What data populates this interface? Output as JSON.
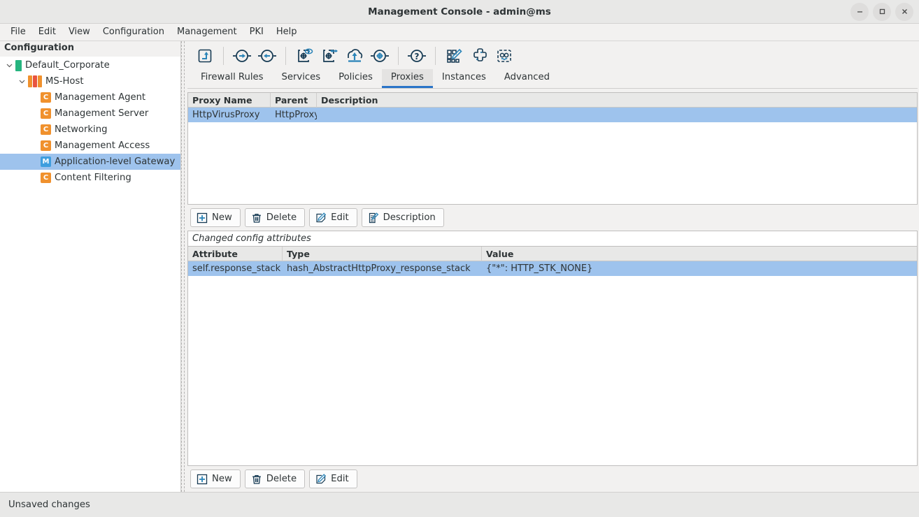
{
  "window": {
    "title": "Management Console - admin@ms",
    "controls": [
      {
        "name": "minimize-button",
        "icon": "minimize-icon"
      },
      {
        "name": "maximize-button",
        "icon": "maximize-icon"
      },
      {
        "name": "close-button",
        "icon": "close-icon"
      }
    ]
  },
  "menubar": {
    "items": [
      "File",
      "Edit",
      "View",
      "Configuration",
      "Management",
      "PKI",
      "Help"
    ]
  },
  "sidebar": {
    "header": "Configuration",
    "items": [
      {
        "label": "Default_Corporate",
        "depth": 0,
        "icon": "green-bar-icon",
        "expanded": true,
        "selected": false
      },
      {
        "label": "MS-Host",
        "depth": 1,
        "icon": "host-bars-icon",
        "expanded": true,
        "selected": false
      },
      {
        "label": "Management Agent",
        "depth": 2,
        "icon": "component-c-icon",
        "badge": "C",
        "selected": false
      },
      {
        "label": "Management Server",
        "depth": 2,
        "icon": "component-c-icon",
        "badge": "C",
        "selected": false
      },
      {
        "label": "Networking",
        "depth": 2,
        "icon": "component-c-icon",
        "badge": "C",
        "selected": false
      },
      {
        "label": "Management Access",
        "depth": 2,
        "icon": "component-c-icon",
        "badge": "C",
        "selected": false
      },
      {
        "label": "Application-level Gateway",
        "depth": 2,
        "icon": "module-m-icon",
        "badge": "M",
        "selected": true
      },
      {
        "label": "Content Filtering",
        "depth": 2,
        "icon": "component-c-icon",
        "badge": "C",
        "selected": false
      }
    ]
  },
  "toolbar": {
    "buttons": [
      {
        "name": "go-up-button",
        "icon": "arrow-up-box-icon"
      },
      {
        "name": "forward-button",
        "icon": "arrow-right-circle-icon"
      },
      {
        "name": "back-button",
        "icon": "arrow-left-circle-icon"
      },
      {
        "name": "view-config-button",
        "icon": "gear-box-eye-icon"
      },
      {
        "name": "transfer-config-button",
        "icon": "gear-box-arrows-icon"
      },
      {
        "name": "upload-button",
        "icon": "cloud-upload-icon"
      },
      {
        "name": "settings-button",
        "icon": "gear-target-icon"
      },
      {
        "name": "help-button",
        "icon": "question-circle-icon"
      },
      {
        "name": "edit-grid-button",
        "icon": "grid-pencil-icon"
      },
      {
        "name": "python-button",
        "icon": "python-icon"
      },
      {
        "name": "robot-button",
        "icon": "robot-icon"
      }
    ]
  },
  "tabs": {
    "items": [
      "Firewall Rules",
      "Services",
      "Policies",
      "Proxies",
      "Instances",
      "Advanced"
    ],
    "active": "Proxies"
  },
  "proxy_table": {
    "columns": [
      "Proxy Name",
      "Parent",
      "Description"
    ],
    "rows": [
      {
        "cells": [
          "HttpVirusProxy",
          "HttpProxy",
          ""
        ],
        "selected": true
      }
    ]
  },
  "proxy_buttons": [
    {
      "label": "New",
      "icon": "plus-box-icon",
      "name": "proxy-new-button"
    },
    {
      "label": "Delete",
      "icon": "trash-icon",
      "name": "proxy-delete-button"
    },
    {
      "label": "Edit",
      "icon": "pencil-box-icon",
      "name": "proxy-edit-button"
    },
    {
      "label": "Description",
      "icon": "document-pencil-icon",
      "name": "proxy-description-button"
    }
  ],
  "attributes_section": {
    "label": "Changed config attributes",
    "columns": [
      "Attribute",
      "Type",
      "Value"
    ],
    "rows": [
      {
        "cells": [
          "self.response_stack",
          "hash_AbstractHttpProxy_response_stack",
          "{\"*\": HTTP_STK_NONE}"
        ],
        "selected": true
      }
    ]
  },
  "attribute_buttons": [
    {
      "label": "New",
      "icon": "plus-box-icon",
      "name": "attribute-new-button"
    },
    {
      "label": "Delete",
      "icon": "trash-icon",
      "name": "attribute-delete-button"
    },
    {
      "label": "Edit",
      "icon": "pencil-box-icon",
      "name": "attribute-edit-button"
    }
  ],
  "statusbar": {
    "message": "Unsaved changes"
  },
  "colors": {
    "selection_blue": "#9ec3ed",
    "accent_blue": "#2a74c8",
    "icon_dark": "#173b54",
    "icon_blue": "#2a84b8",
    "component_orange": "#f0912d",
    "module_blue": "#3e9ede",
    "host_red": "#e8543f",
    "tree_green": "#26b47f"
  }
}
